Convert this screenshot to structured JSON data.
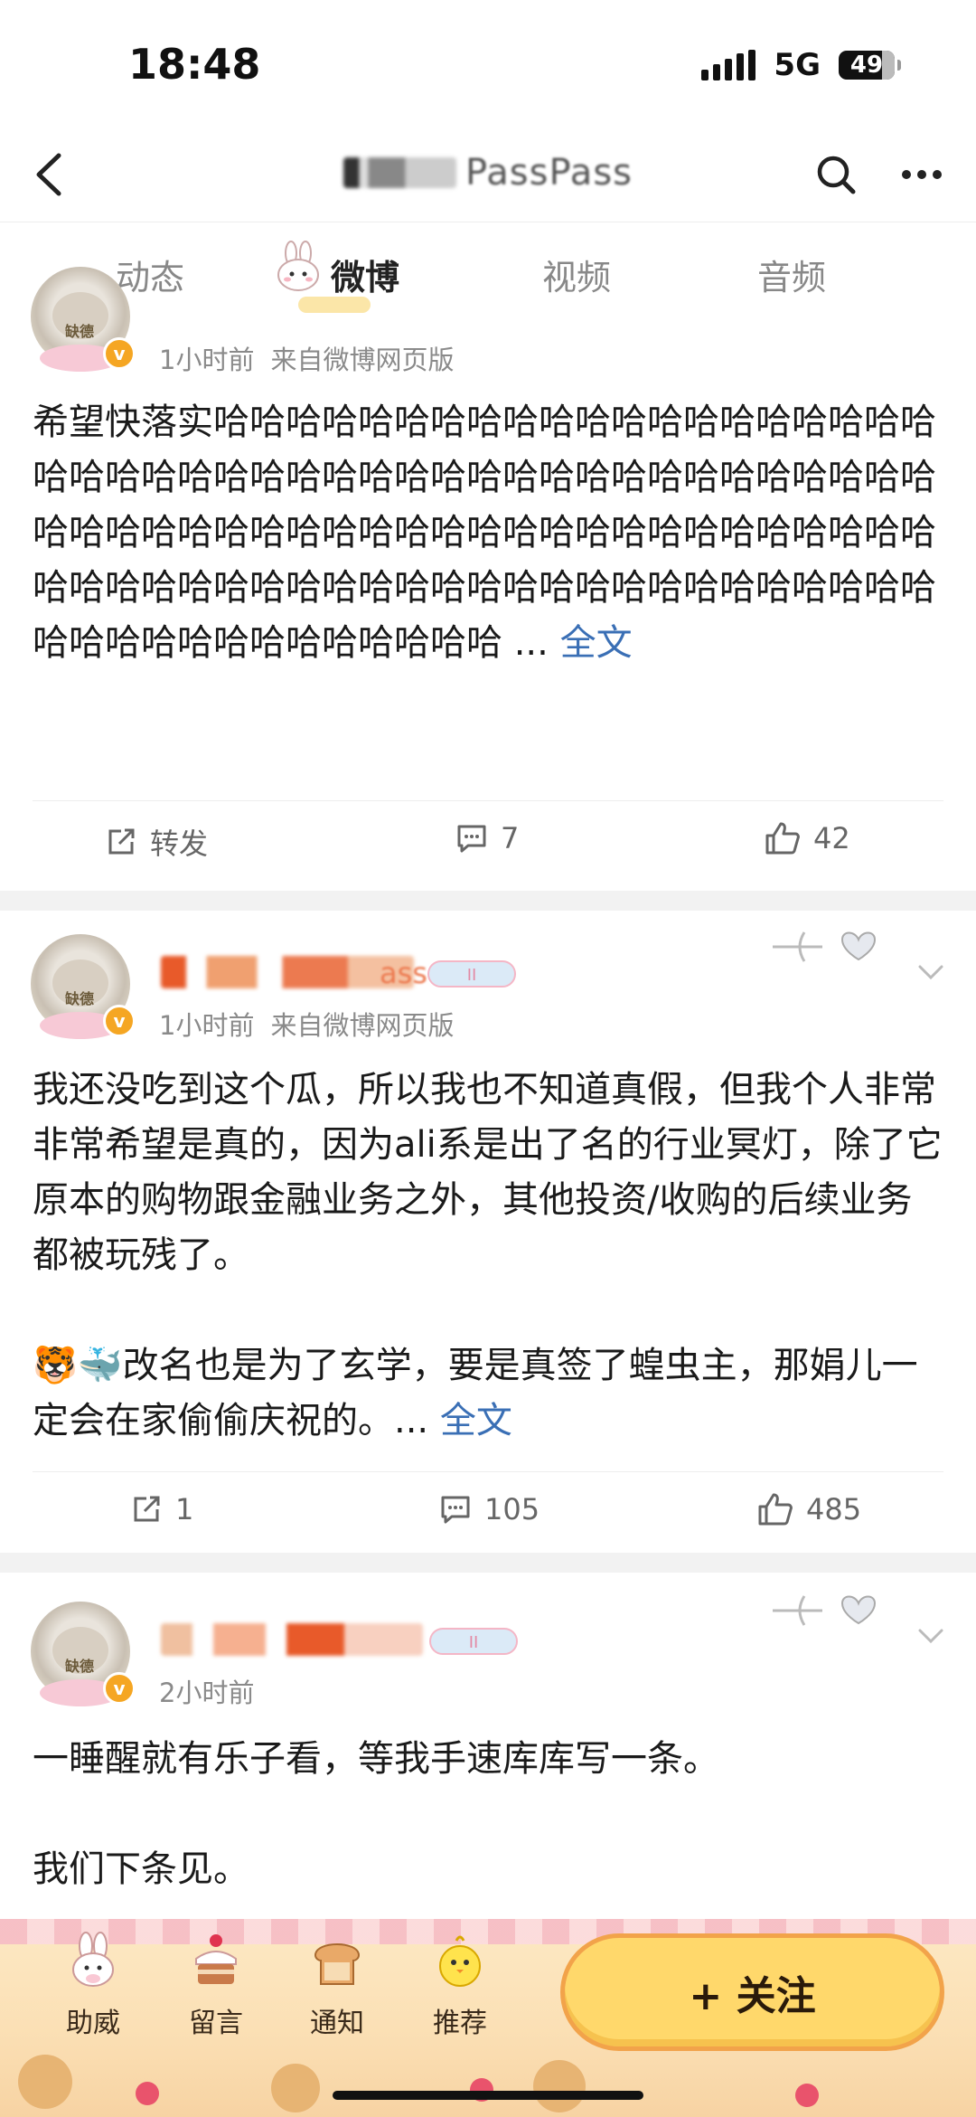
{
  "status_bar": {
    "time": "18:48",
    "network": "5G",
    "battery": "49"
  },
  "header": {
    "title_visible": "PassPass"
  },
  "tabs": [
    {
      "label": "动态",
      "active": false
    },
    {
      "label": "微博",
      "active": true
    },
    {
      "label": "视频",
      "active": false
    },
    {
      "label": "音频",
      "active": false
    }
  ],
  "posts": [
    {
      "time": "1小时前",
      "source": "来自微博网页版",
      "text": "希望快落实哈哈哈哈哈哈哈哈哈哈哈哈哈哈哈哈哈哈哈哈哈哈哈哈哈哈哈哈哈哈哈哈哈哈哈哈哈哈哈哈哈哈哈哈哈哈哈哈哈哈哈哈哈哈哈哈哈哈哈哈哈哈哈哈哈哈哈哈哈哈哈哈哈哈哈哈哈哈哈哈哈哈哈哈哈哈哈哈哈哈哈哈哈哈哈哈哈哈哈哈哈哈哈哈哈哈哈哈",
      "ellipsis": " ... ",
      "full_text_link": "全文",
      "repost_label": "转发",
      "comments": "7",
      "likes": "42"
    },
    {
      "name_visible": "ass",
      "time": "1小时前",
      "source": "来自微博网页版",
      "text_p1": "我还没吃到这个瓜，所以我也不知道真假，但我个人非常非常希望是真的，因为ali系是出了名的行业冥灯，除了它原本的购物跟金融业务之外，其他投资/收购的后续业务都被玩残了。",
      "text_p2": "改名也是为了玄学，要是真签了蝗虫主，那娟儿一定会在家偷偷庆祝的。",
      "emoji_1": "🐯",
      "emoji_2": "🐳",
      "ellipsis": "... ",
      "full_text_link": "全文",
      "reposts": "1",
      "comments": "105",
      "likes": "485"
    },
    {
      "time": "2小时前",
      "text_p1": "一睡醒就有乐子看，等我手速库库写一条。",
      "text_p2": "我们下条见。"
    }
  ],
  "bottom_bar": {
    "items": [
      {
        "label": "助威",
        "icon": "bunny-icon"
      },
      {
        "label": "留言",
        "icon": "cake-icon"
      },
      {
        "label": "通知",
        "icon": "bread-icon"
      },
      {
        "label": "推荐",
        "icon": "chick-icon"
      }
    ],
    "follow_label": "+ 关注"
  },
  "colors": {
    "link": "#3a6fb5",
    "verified_badge": "#f5a623",
    "follow_button": "#ffd86b"
  }
}
